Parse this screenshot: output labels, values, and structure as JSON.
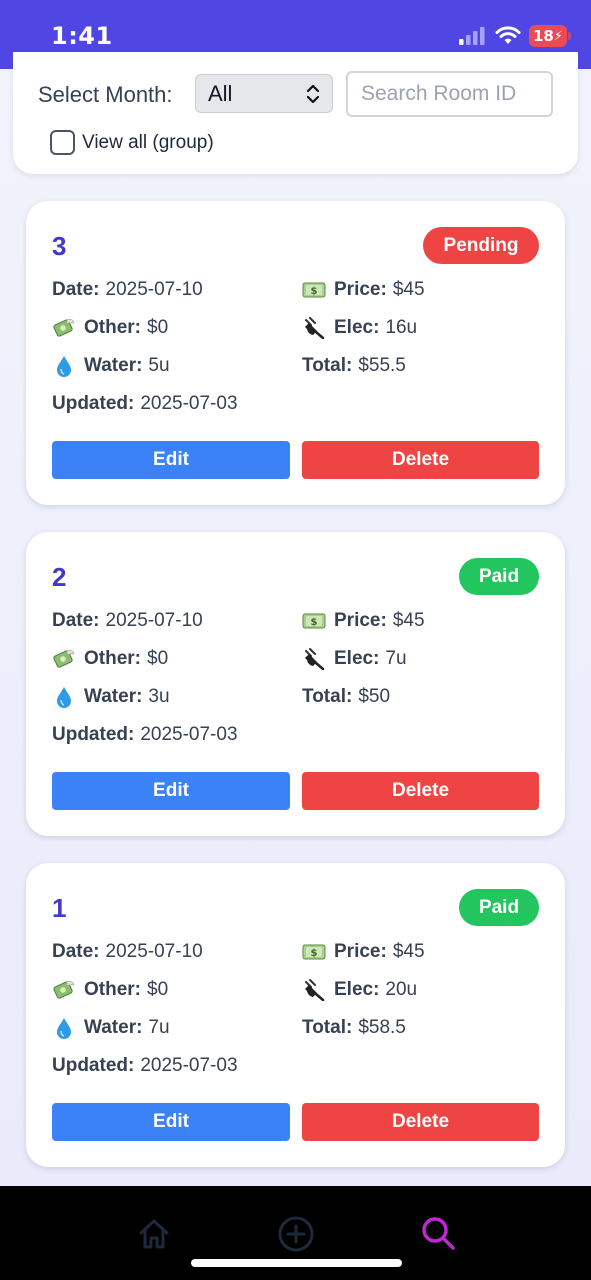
{
  "status_bar": {
    "time": "1:41",
    "battery": "18"
  },
  "filters": {
    "month_label": "Select Month:",
    "month_value": "All",
    "search_placeholder": "Search Room ID",
    "view_all_label": "View all (group)"
  },
  "labels": {
    "date": "Date:",
    "other": "Other:",
    "water": "Water:",
    "updated": "Updated:",
    "price": "Price:",
    "elec": "Elec:",
    "total": "Total:",
    "edit": "Edit",
    "delete": "Delete"
  },
  "records": [
    {
      "room_id": "3",
      "status": "Pending",
      "date": "2025-07-10",
      "other": "$0",
      "water": "5u",
      "updated": "2025-07-03",
      "price": "$45",
      "elec": "16u",
      "total": "$55.5"
    },
    {
      "room_id": "2",
      "status": "Paid",
      "date": "2025-07-10",
      "other": "$0",
      "water": "3u",
      "updated": "2025-07-03",
      "price": "$45",
      "elec": "7u",
      "total": "$50"
    },
    {
      "room_id": "1",
      "status": "Paid",
      "date": "2025-07-10",
      "other": "$0",
      "water": "7u",
      "updated": "2025-07-03",
      "price": "$45",
      "elec": "20u",
      "total": "$58.5"
    }
  ],
  "colors": {
    "header": "#5046e4",
    "room_id": "#4338ca",
    "pending": "#ef4444",
    "paid": "#22c55e",
    "edit": "#3b82f6",
    "delete": "#ef4444",
    "active_nav": "#c026d3"
  },
  "nav": {
    "items": [
      "home-icon",
      "plus-circle-icon",
      "search-icon"
    ],
    "active": "search-icon"
  }
}
